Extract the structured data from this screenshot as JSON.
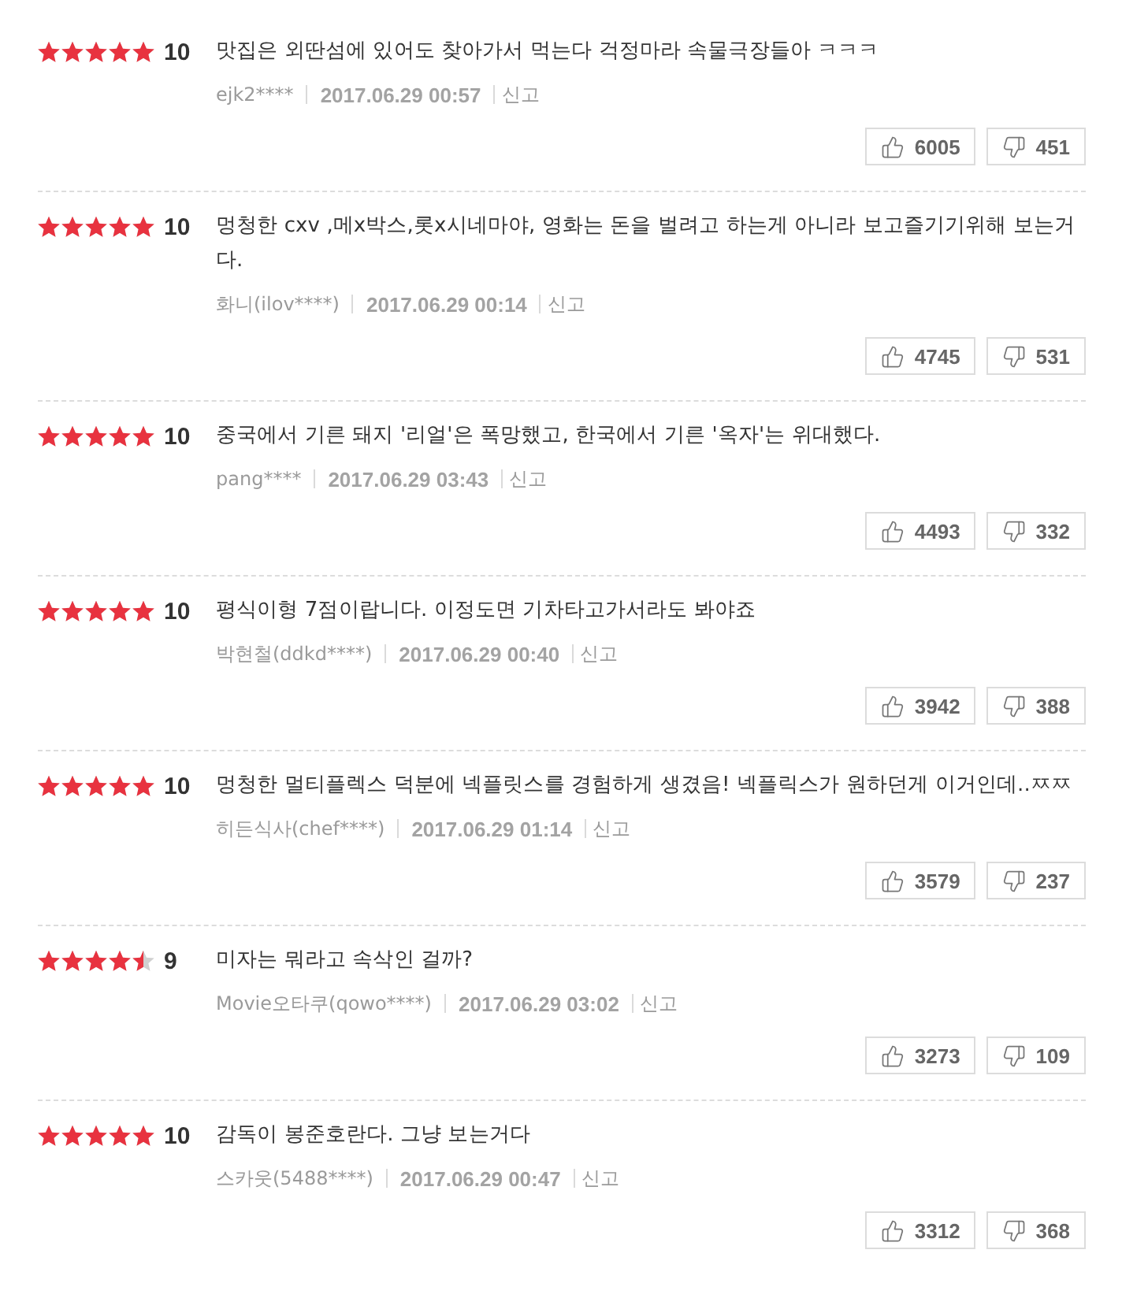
{
  "reviews": [
    {
      "stars": 5,
      "score": "10",
      "text": "맛집은 외딴섬에 있어도 찾아가서 먹는다 걱정마라 속물극장들아 ㅋㅋㅋ",
      "author": "ejk2****",
      "date": "2017.06.29 00:57",
      "report": "신고",
      "likes": "6005",
      "dislikes": "451"
    },
    {
      "stars": 5,
      "score": "10",
      "text": "멍청한 cxv ,메x박스,롯x시네마야, 영화는 돈을 벌려고 하는게 아니라 보고즐기기위해 보는거다.",
      "author": "화니(ilov****)",
      "date": "2017.06.29 00:14",
      "report": "신고",
      "likes": "4745",
      "dislikes": "531"
    },
    {
      "stars": 5,
      "score": "10",
      "text": "중국에서 기른 돼지 '리얼'은 폭망했고, 한국에서 기른 '옥자'는 위대했다.",
      "author": "pang****",
      "date": "2017.06.29 03:43",
      "report": "신고",
      "likes": "4493",
      "dislikes": "332"
    },
    {
      "stars": 5,
      "score": "10",
      "text": "평식이형 7점이랍니다. 이정도면 기차타고가서라도 봐야죠",
      "author": "박현철(ddkd****)",
      "date": "2017.06.29 00:40",
      "report": "신고",
      "likes": "3942",
      "dislikes": "388"
    },
    {
      "stars": 5,
      "score": "10",
      "text": "멍청한 멀티플렉스 덕분에 넥플릿스를 경험하게 생겼음! 넥플릭스가 원하던게 이거인데..ㅉㅉ",
      "author": "히든식사(chef****)",
      "date": "2017.06.29 01:14",
      "report": "신고",
      "likes": "3579",
      "dislikes": "237"
    },
    {
      "stars": 4.5,
      "score": "9",
      "text": "미자는 뭐라고 속삭인 걸까?",
      "author": "Movie오타쿠(qowo****)",
      "date": "2017.06.29 03:02",
      "report": "신고",
      "likes": "3273",
      "dislikes": "109"
    },
    {
      "stars": 5,
      "score": "10",
      "text": "감독이 봉준호란다. 그냥 보는거다",
      "author": "스카웃(5488****)",
      "date": "2017.06.29 00:47",
      "report": "신고",
      "likes": "3312",
      "dislikes": "368"
    }
  ]
}
